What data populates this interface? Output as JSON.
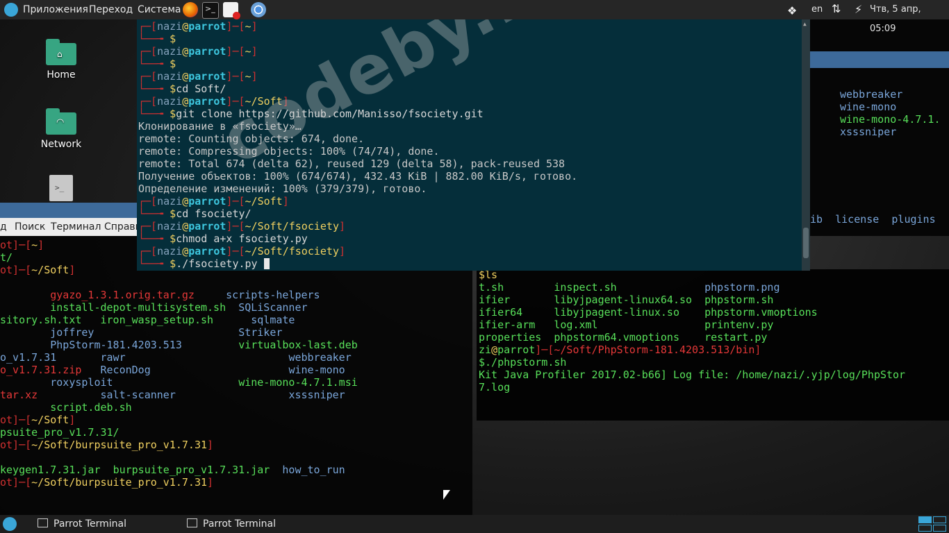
{
  "top_panel": {
    "menus": [
      "Приложения",
      "Переход",
      "Система"
    ],
    "launchers": [
      "firefox-icon",
      "terminal-icon",
      "text-editor-icon",
      "chromium-icon"
    ],
    "keyboard_layout": "en",
    "clock": "Чтв, 5 апр, 05:09"
  },
  "desktop": {
    "icons": [
      {
        "label": "Home"
      },
      {
        "label": "Network"
      }
    ]
  },
  "watermark": "codeby.net",
  "bottom_panel": {
    "tasks": [
      "Parrot Terminal",
      "Parrot Terminal"
    ]
  },
  "main_terminal": {
    "lines": [
      [
        [
          "c-red",
          "┌─["
        ],
        [
          "c-nm",
          "nazi"
        ],
        [
          "c-at",
          "@"
        ],
        [
          "c-host",
          "parrot"
        ],
        [
          "c-red",
          "]─["
        ],
        [
          "c-yel",
          "~"
        ],
        [
          "c-red",
          "]"
        ]
      ],
      [
        [
          "c-red",
          "└──╼ "
        ],
        [
          "c-yel",
          "$"
        ]
      ],
      [
        [
          "c-red",
          "┌─["
        ],
        [
          "c-nm",
          "nazi"
        ],
        [
          "c-at",
          "@"
        ],
        [
          "c-host",
          "parrot"
        ],
        [
          "c-red",
          "]─["
        ],
        [
          "c-yel",
          "~"
        ],
        [
          "c-red",
          "]"
        ]
      ],
      [
        [
          "c-red",
          "└──╼ "
        ],
        [
          "c-yel",
          "$"
        ]
      ],
      [
        [
          "c-red",
          "┌─["
        ],
        [
          "c-nm",
          "nazi"
        ],
        [
          "c-at",
          "@"
        ],
        [
          "c-host",
          "parrot"
        ],
        [
          "c-red",
          "]─["
        ],
        [
          "c-yel",
          "~"
        ],
        [
          "c-red",
          "]"
        ]
      ],
      [
        [
          "c-red",
          "└──╼ "
        ],
        [
          "c-yel",
          "$"
        ],
        [
          "c-wh",
          "cd Soft/"
        ]
      ],
      [
        [
          "c-red",
          "┌─["
        ],
        [
          "c-nm",
          "nazi"
        ],
        [
          "c-at",
          "@"
        ],
        [
          "c-host",
          "parrot"
        ],
        [
          "c-red",
          "]─["
        ],
        [
          "c-yel",
          "~/Soft"
        ],
        [
          "c-red",
          "]"
        ]
      ],
      [
        [
          "c-red",
          "└──╼ "
        ],
        [
          "c-yel",
          "$"
        ],
        [
          "c-wh",
          "git clone https://github.com/Manisso/fsociety.git"
        ]
      ],
      [
        [
          "c-out",
          "Клонирование в «fsociety»…"
        ]
      ],
      [
        [
          "c-out",
          "remote: Counting objects: 674, done."
        ]
      ],
      [
        [
          "c-out",
          "remote: Compressing objects: 100% (74/74), done."
        ]
      ],
      [
        [
          "c-out",
          "remote: Total 674 (delta 62), reused 129 (delta 58), pack-reused 538"
        ]
      ],
      [
        [
          "c-out",
          "Получение объектов: 100% (674/674), 432.43 KiB | 882.00 KiB/s, готово."
        ]
      ],
      [
        [
          "c-out",
          "Определение изменений: 100% (379/379), готово."
        ]
      ],
      [
        [
          "c-red",
          "┌─["
        ],
        [
          "c-nm",
          "nazi"
        ],
        [
          "c-at",
          "@"
        ],
        [
          "c-host",
          "parrot"
        ],
        [
          "c-red",
          "]─["
        ],
        [
          "c-yel",
          "~/Soft"
        ],
        [
          "c-red",
          "]"
        ]
      ],
      [
        [
          "c-red",
          "└──╼ "
        ],
        [
          "c-yel",
          "$"
        ],
        [
          "c-wh",
          "cd fsociety/"
        ]
      ],
      [
        [
          "c-red",
          "┌─["
        ],
        [
          "c-nm",
          "nazi"
        ],
        [
          "c-at",
          "@"
        ],
        [
          "c-host",
          "parrot"
        ],
        [
          "c-red",
          "]─["
        ],
        [
          "c-yel",
          "~/Soft/fsociety"
        ],
        [
          "c-red",
          "]"
        ]
      ],
      [
        [
          "c-red",
          "└──╼ "
        ],
        [
          "c-yel",
          "$"
        ],
        [
          "c-wh",
          "chmod a+x fsociety.py"
        ]
      ],
      [
        [
          "c-red",
          "┌─["
        ],
        [
          "c-nm",
          "nazi"
        ],
        [
          "c-at",
          "@"
        ],
        [
          "c-host",
          "parrot"
        ],
        [
          "c-red",
          "]─["
        ],
        [
          "c-yel",
          "~/Soft/fsociety"
        ],
        [
          "c-red",
          "]"
        ]
      ],
      [
        [
          "c-red",
          "└──╼ "
        ],
        [
          "c-yel",
          "$"
        ],
        [
          "c-wh",
          "./fsociety.py "
        ]
      ]
    ]
  },
  "left_terminal": {
    "menu": [
      "д",
      "Поиск",
      "Терминал",
      "Справка"
    ],
    "lines": [
      [
        [
          "c-red",
          "ot]─["
        ],
        [
          "c-yel",
          "~"
        ],
        [
          "c-red",
          "]"
        ]
      ],
      [
        [
          "c-gn",
          "t/"
        ]
      ],
      [
        [
          "c-red",
          "ot]─["
        ],
        [
          "c-yel",
          "~/Soft"
        ],
        [
          "c-red",
          "]"
        ]
      ],
      [
        [
          "c-wh",
          " "
        ]
      ],
      [
        [
          "c-wh",
          "        "
        ],
        [
          "c-rd",
          "gyazo_1.3.1.orig.tar.gz"
        ],
        [
          "c-wh",
          "     "
        ],
        [
          "c-bl",
          "scripts-helpers"
        ]
      ],
      [
        [
          "c-wh",
          "        "
        ],
        [
          "c-gn",
          "install-depot-multisystem.sh"
        ],
        [
          "c-wh",
          "  "
        ],
        [
          "c-bl",
          "SQLiScanner"
        ]
      ],
      [
        [
          "c-gn",
          "sitory.sh.txt"
        ],
        [
          "c-wh",
          "   "
        ],
        [
          "c-gn",
          "iron_wasp_setup.sh"
        ],
        [
          "c-wh",
          "      "
        ],
        [
          "c-bl",
          "sqlmate"
        ]
      ],
      [
        [
          "c-wh",
          "        "
        ],
        [
          "c-bl",
          "joffrey"
        ],
        [
          "c-wh",
          "                       "
        ],
        [
          "c-bl",
          "Striker"
        ]
      ],
      [
        [
          "c-wh",
          "        "
        ],
        [
          "c-bl",
          "PhpStorm-181.4203.513"
        ],
        [
          "c-wh",
          "         "
        ],
        [
          "c-gn",
          "virtualbox-last.deb"
        ]
      ],
      [
        [
          "c-bl",
          "o_v1.7.31"
        ],
        [
          "c-wh",
          "       "
        ],
        [
          "c-bl",
          "rawr"
        ],
        [
          "c-wh",
          "                          "
        ],
        [
          "c-bl",
          "webbreaker"
        ]
      ],
      [
        [
          "c-rd",
          "o_v1.7.31.zip"
        ],
        [
          "c-wh",
          "   "
        ],
        [
          "c-bl",
          "ReconDog"
        ],
        [
          "c-wh",
          "                      "
        ],
        [
          "c-bl",
          "wine-mono"
        ]
      ],
      [
        [
          "c-wh",
          "        "
        ],
        [
          "c-bl",
          "roxysploit"
        ],
        [
          "c-wh",
          "                    "
        ],
        [
          "c-gn",
          "wine-mono-4.7.1.msi"
        ]
      ],
      [
        [
          "c-rd",
          "tar.xz"
        ],
        [
          "c-wh",
          "          "
        ],
        [
          "c-bl",
          "salt-scanner"
        ],
        [
          "c-wh",
          "                  "
        ],
        [
          "c-bl",
          "xsssniper"
        ]
      ],
      [
        [
          "c-wh",
          "        "
        ],
        [
          "c-gn",
          "script.deb.sh"
        ]
      ],
      [
        [
          "c-red",
          "ot]─["
        ],
        [
          "c-yel",
          "~/Soft"
        ],
        [
          "c-red",
          "]"
        ]
      ],
      [
        [
          "c-gn",
          "psuite_pro_v1.7.31/"
        ]
      ],
      [
        [
          "c-red",
          "ot]─["
        ],
        [
          "c-yel",
          "~/Soft/burpsuite_pro_v1.7.31"
        ],
        [
          "c-red",
          "]"
        ]
      ],
      [
        [
          "c-wh",
          " "
        ]
      ],
      [
        [
          "c-gn",
          "keygen1.7.31.jar"
        ],
        [
          "c-wh",
          "  "
        ],
        [
          "c-gn",
          "burpsuite_pro_v1.7.31.jar"
        ],
        [
          "c-wh",
          "  "
        ],
        [
          "c-bl",
          "how_to_run"
        ]
      ],
      [
        [
          "c-red",
          "ot]─["
        ],
        [
          "c-yel",
          "~/Soft/burpsuite_pro_v1.7.31"
        ],
        [
          "c-red",
          "]"
        ]
      ]
    ]
  },
  "right_terminal": {
    "lines": [
      [
        [
          "c-yel",
          "$ls"
        ]
      ],
      [
        [
          "c-gn",
          "t.sh"
        ],
        [
          "c-wh",
          "        "
        ],
        [
          "c-gn",
          "inspect.sh"
        ],
        [
          "c-wh",
          "              "
        ],
        [
          "c-bl",
          "phpstorm.png"
        ]
      ],
      [
        [
          "c-gn",
          "ifier"
        ],
        [
          "c-wh",
          "       "
        ],
        [
          "c-gn",
          "libyjpagent-linux64.so"
        ],
        [
          "c-wh",
          "  "
        ],
        [
          "c-gn",
          "phpstorm.sh"
        ]
      ],
      [
        [
          "c-gn",
          "ifier64"
        ],
        [
          "c-wh",
          "     "
        ],
        [
          "c-gn",
          "libyjpagent-linux.so"
        ],
        [
          "c-wh",
          "    "
        ],
        [
          "c-gn",
          "phpstorm.vmoptions"
        ]
      ],
      [
        [
          "c-gn",
          "ifier-arm"
        ],
        [
          "c-wh",
          "   "
        ],
        [
          "c-gn",
          "log.xml"
        ],
        [
          "c-wh",
          "                 "
        ],
        [
          "c-gn",
          "printenv.py"
        ]
      ],
      [
        [
          "c-gn",
          "properties"
        ],
        [
          "c-wh",
          "  "
        ],
        [
          "c-gn",
          "phpstorm64.vmoptions"
        ],
        [
          "c-wh",
          "    "
        ],
        [
          "c-gn",
          "restart.py"
        ]
      ],
      [
        [
          "c-gn",
          "zi"
        ],
        [
          "c-at",
          "@"
        ],
        [
          "c-gn",
          "parrot"
        ],
        [
          "c-red",
          "]─["
        ],
        [
          "c-rd",
          "~/Soft/PhpStorm-181.4203.513/bin"
        ],
        [
          "c-red",
          "]"
        ]
      ],
      [
        [
          "c-gn",
          "$./phpstorm.sh"
        ]
      ],
      [
        [
          "c-gn",
          "Kit Java Profiler 2017.02-b66] Log file: /home/nazi/.yjp/log/PhpStor"
        ]
      ],
      [
        [
          "c-gn",
          "7.log"
        ]
      ]
    ]
  },
  "top_right_terminal": {
    "lines": [
      [
        [
          "c-bl",
          "webbreaker"
        ]
      ],
      [
        [
          "c-bl",
          "wine-mono"
        ]
      ],
      [
        [
          "c-gn",
          "wine-mono-4.7.1."
        ]
      ],
      [
        [
          "c-bl",
          "xsssniper"
        ]
      ]
    ],
    "footer": [
      [
        "c-bl",
        "ib  license  plugins"
      ]
    ]
  }
}
